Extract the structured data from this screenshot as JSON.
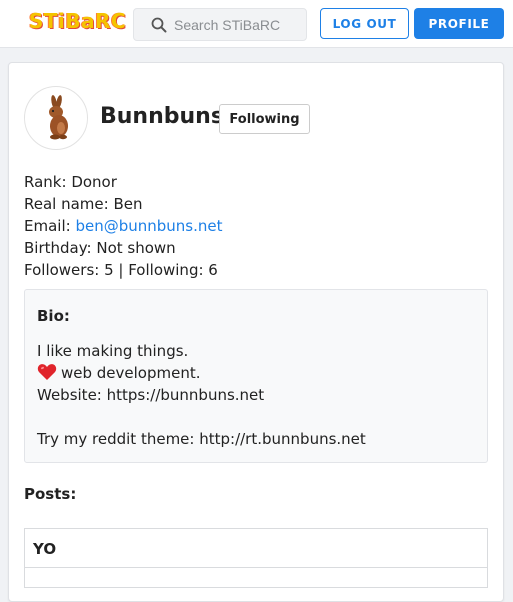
{
  "header": {
    "logo_text": "STiBaRC",
    "search_placeholder": "Search STiBaRC",
    "search_value": "",
    "logout_label": "LOG OUT",
    "profile_label": "PROFILE"
  },
  "profile": {
    "username": "Bunnbuns",
    "follow_label": "Following",
    "rank_label": "Rank: ",
    "rank_value": "Donor",
    "realname_label": "Real name: ",
    "realname_value": "Ben",
    "email_label": "Email: ",
    "email_value": "ben@bunnbuns.net",
    "birthday_label": "Birthday: ",
    "birthday_value": "Not shown",
    "followers_text": "Followers: 5 | Following: 6"
  },
  "bio": {
    "title": "Bio:",
    "line1": "I like making things.",
    "line2": "web development.",
    "line3": "Website: https://bunnbuns.net",
    "line4": "Try my reddit theme: http://rt.bunnbuns.net"
  },
  "posts": {
    "title": "Posts:",
    "items": [
      {
        "title": "YO"
      }
    ]
  },
  "colors": {
    "accent": "#1e80e6",
    "logo": "#f5c400"
  },
  "icons": {
    "search": "search-icon",
    "heart": "heart-icon",
    "avatar": "bunny-avatar-icon"
  }
}
